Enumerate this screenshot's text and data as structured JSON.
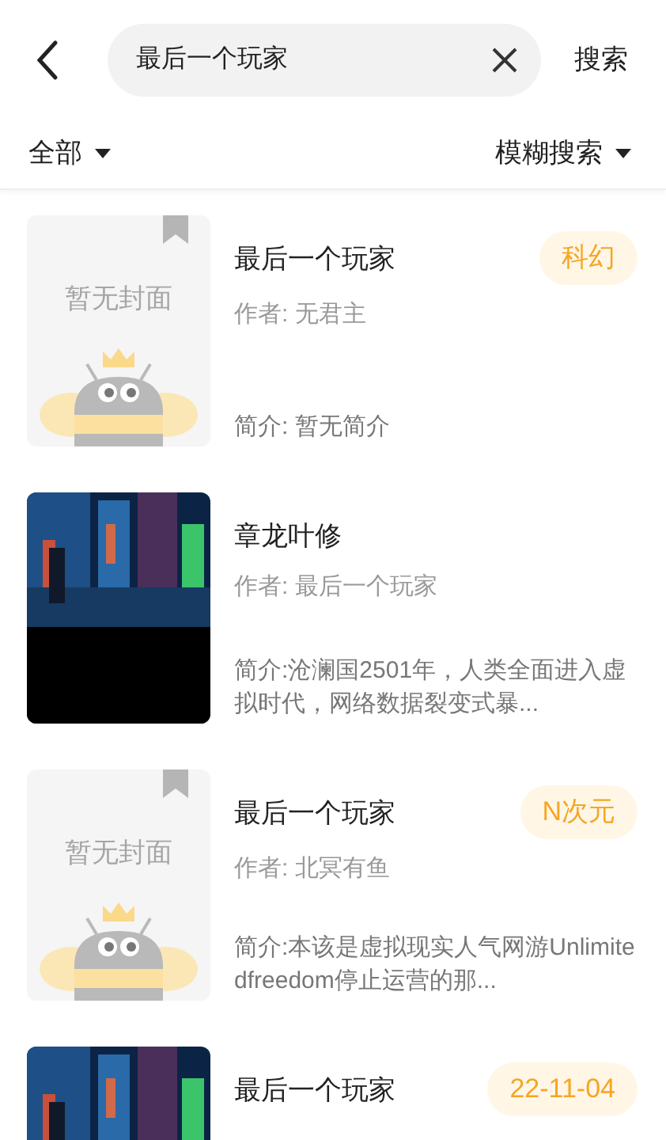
{
  "search": {
    "value": "最后一个玩家",
    "button": "搜索"
  },
  "filters": {
    "left": "全部",
    "right": "模糊搜索"
  },
  "results": [
    {
      "cover": {
        "kind": "placeholder",
        "text": "暂无封面"
      },
      "title": "最后一个玩家",
      "tag": "科幻",
      "author": "作者: 无君主",
      "intro": "简介: 暂无简介"
    },
    {
      "title": "章龙叶修",
      "author": "作者: 最后一个玩家",
      "intro": "简介:沧澜国2501年，人类全面进入虚拟时代，网络数据裂变式暴..."
    },
    {
      "cover": {
        "kind": "placeholder",
        "text": "暂无封面"
      },
      "title": "最后一个玩家",
      "tag": "N次元",
      "author": "作者: 北冥有鱼",
      "intro": "简介:本该是虚拟现实人气网游Unlimitedfreedom停止运营的那..."
    },
    {
      "title": "最后一个玩家",
      "tag": "22-11-04"
    }
  ]
}
